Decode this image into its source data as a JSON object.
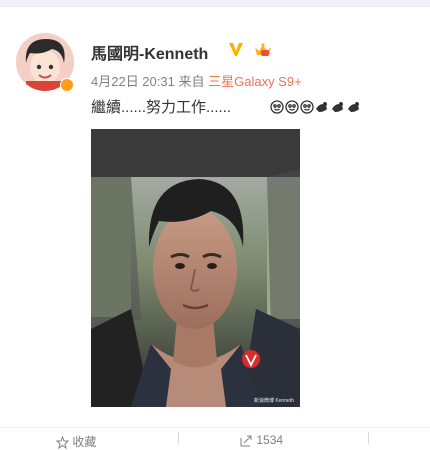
{
  "post": {
    "author_name": "馬國明-Kenneth",
    "date": "4月22日 20:31",
    "source_prefix": "来自",
    "source_device": "三星Galaxy S9+",
    "text": "繼續......努力工作......",
    "image_watermark": "新浪微博 Kenneth"
  },
  "badges": {
    "verified_icon": "vip-v-icon",
    "member_icon": "weibo-member-crown-icon",
    "verified_color": "#f7b500"
  },
  "emojis": [
    "smile-emoji",
    "smile-emoji",
    "smile-emoji",
    "strong-arm-emoji",
    "strong-arm-emoji",
    "strong-arm-emoji"
  ],
  "actions": {
    "favorite_label": "收藏",
    "share_count": "1534",
    "accent": "#eb7350"
  }
}
